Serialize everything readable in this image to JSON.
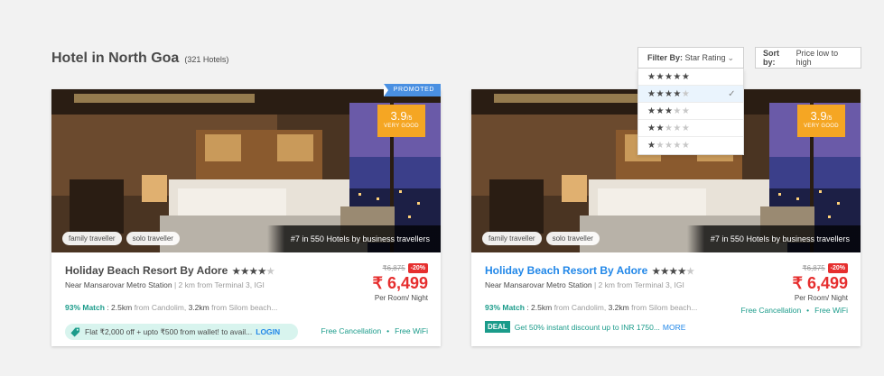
{
  "header": {
    "title": "Hotel in North Goa",
    "count": "(321 Hotels)"
  },
  "filter": {
    "label": "Filter By:",
    "value": "Star Rating",
    "options": [
      {
        "stars": 5,
        "selected": false
      },
      {
        "stars": 4,
        "selected": true
      },
      {
        "stars": 3,
        "selected": false
      },
      {
        "stars": 2,
        "selected": false
      },
      {
        "stars": 1,
        "selected": false
      }
    ]
  },
  "sort": {
    "label": "Sort by:",
    "value": "Price low to high"
  },
  "cards": [
    {
      "promoted": "PROMOTED",
      "rating": "3.9",
      "rating_max": "/5",
      "rating_label": "VERY GOOD",
      "chips": [
        "family traveller",
        "solo traveller"
      ],
      "rank": "#7 in 550 Hotels by business travellers",
      "name": "Holiday Beach Resort By Adore",
      "stars": 4,
      "location": "Near Mansarovar Metro Station",
      "distance": "2 km from Terminal 3, IGI",
      "match_pct": "93% Match",
      "match_text1": ": 2.5km",
      "match_muted1": "from Candolim,",
      "match_text2": "3.2km",
      "match_muted2": "from Silom beach...",
      "old_price": "₹6,875",
      "discount": "-20%",
      "price": "₹ 6,499",
      "per": "Per Room/ Night",
      "offer": {
        "text": "Flat ₹2,000 off + upto ₹500 from wallet! to avail...",
        "action": "LOGIN"
      },
      "amenities": [
        "Free Cancellation",
        "Free WiFi"
      ]
    },
    {
      "rating": "3.9",
      "rating_max": "/5",
      "rating_label": "VERY GOOD",
      "chips": [
        "family traveller",
        "solo traveller"
      ],
      "rank": "#7 in 550 Hotels by business travellers",
      "name": "Holiday Beach Resort By Adore",
      "stars": 4,
      "location": "Near Mansarovar Metro Station",
      "distance": "2 km from Terminal 3, IGI",
      "match_pct": "93% Match",
      "match_text1": ": 2.5km",
      "match_muted1": "from Candolim,",
      "match_text2": "3.2km",
      "match_muted2": "from Silom beach...",
      "old_price": "₹6,875",
      "discount": "-20%",
      "price": "₹ 6,499",
      "per": "Per Room/ Night",
      "deal": {
        "badge": "DEAL",
        "text": "Get 50% instant discount up to INR 1750...",
        "action": "MORE"
      },
      "amenities": [
        "Free Cancellation",
        "Free WiFi"
      ]
    }
  ],
  "colors": {
    "accent": "#2187e8",
    "rating": "#f5a623",
    "price": "#e62e2e",
    "teal": "#1a9b8a",
    "promoted": "#4a90e2"
  }
}
